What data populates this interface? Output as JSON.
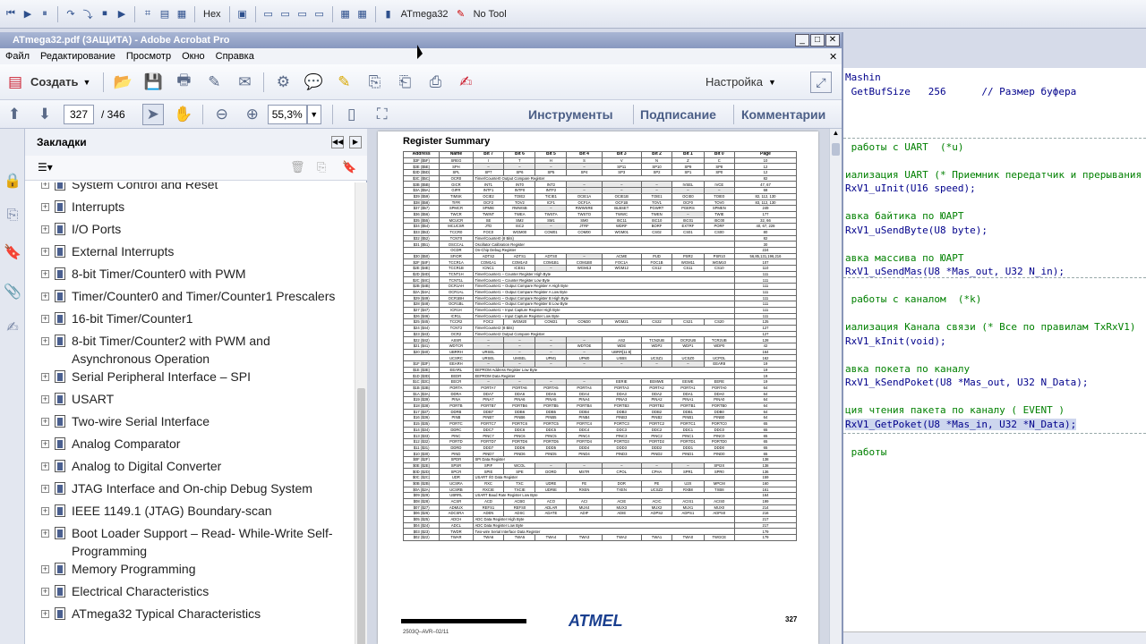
{
  "ide": {
    "toolbar_hex": "Hex",
    "device": "ATmega32",
    "tool": "No Tool"
  },
  "acrobat": {
    "title": "ATmega32.pdf (ЗАЩИТА) - Adobe Acrobat Pro",
    "menu": [
      "Файл",
      "Редактирование",
      "Просмотр",
      "Окно",
      "Справка"
    ],
    "create_label": "Создать",
    "customize_label": "Настройка",
    "page_current": "327",
    "page_total": "/ 346",
    "zoom": "55,3%",
    "nav": {
      "tools": "Инструменты",
      "sign": "Подписание",
      "comments": "Комментарии"
    },
    "bookmarks_title": "Закладки",
    "bookmarks": [
      "System Control and Reset",
      "Interrupts",
      "I/O Ports",
      "External Interrupts",
      "8-bit Timer/Counter0 with PWM",
      "Timer/Counter0 and Timer/Counter1 Prescalers",
      "16-bit Timer/Counter1",
      "8-bit Timer/Counter2 with PWM and",
      "Asynchronous Operation",
      "Serial Peripheral Interface – SPI",
      "USART",
      "Two-wire Serial Interface",
      "Analog Comparator",
      "Analog to Digital Converter",
      "JTAG Interface and On-chip Debug System",
      "IEEE 1149.1 (JTAG) Boundary-scan",
      "Boot Loader Support – Read- While-Write Self-",
      "Programming",
      "Memory Programming",
      "Electrical Characteristics",
      "ATmega32 Typical Characteristics"
    ],
    "doc": {
      "heading": "Register Summary",
      "columns": [
        "Address",
        "Name",
        "Bit 7",
        "Bit 6",
        "Bit 5",
        "Bit 4",
        "Bit 3",
        "Bit 2",
        "Bit 1",
        "Bit 0",
        "Page"
      ],
      "rows": [
        [
          "$3F ($5F)",
          "SREG",
          "I",
          "T",
          "H",
          "S",
          "V",
          "N",
          "Z",
          "C",
          "10"
        ],
        [
          "$3E ($5E)",
          "SPH",
          "–",
          "–",
          "–",
          "–",
          "SP11",
          "SP10",
          "SP9",
          "SP8",
          "12"
        ],
        [
          "$3D ($5D)",
          "SPL",
          "SP7",
          "SP6",
          "SP5",
          "SP4",
          "SP3",
          "SP2",
          "SP1",
          "SP0",
          "12"
        ],
        [
          "$3C ($5C)",
          "OCR0",
          "",
          "",
          "",
          "",
          "",
          "",
          "",
          "",
          "82"
        ],
        [
          "$3B ($5B)",
          "GICR",
          "INT1",
          "INT0",
          "INT2",
          "–",
          "–",
          "–",
          "IVSEL",
          "IVCE",
          "47, 67"
        ],
        [
          "$3A ($5A)",
          "GIFR",
          "INTF1",
          "INTF0",
          "INTF2",
          "–",
          "–",
          "–",
          "–",
          "–",
          "68"
        ],
        [
          "$39 ($59)",
          "TIMSK",
          "OCIE2",
          "TOIE2",
          "TICIE1",
          "OCIE1A",
          "OCIE1B",
          "TOIE1",
          "OCIE0",
          "TOIE0",
          "82, 112, 130"
        ],
        [
          "$38 ($58)",
          "TIFR",
          "OCF2",
          "TOV2",
          "ICF1",
          "OCF1A",
          "OCF1B",
          "TOV1",
          "OCF0",
          "TOV0",
          "83, 112, 130"
        ],
        [
          "$37 ($57)",
          "SPMCR",
          "SPMIE",
          "RWWSB",
          "–",
          "RWWSRE",
          "BLBSET",
          "PGWRT",
          "PGERS",
          "SPMEN",
          "249"
        ],
        [
          "$36 ($56)",
          "TWCR",
          "TWINT",
          "TWEA",
          "TWSTA",
          "TWSTO",
          "TWWC",
          "TWEN",
          "–",
          "TWIE",
          "177"
        ],
        [
          "$35 ($55)",
          "MCUCR",
          "SE",
          "SM2",
          "SM1",
          "SM0",
          "ISC11",
          "ISC10",
          "ISC01",
          "ISC00",
          "32, 66"
        ],
        [
          "$34 ($54)",
          "MCUCSR",
          "JTD",
          "ISC2",
          "–",
          "JTRF",
          "WDRF",
          "BORF",
          "EXTRF",
          "PORF",
          "40, 67, 228"
        ],
        [
          "$33 ($53)",
          "TCCR0",
          "FOC0",
          "WGM00",
          "COM01",
          "COM00",
          "WGM01",
          "CS02",
          "CS01",
          "CS00",
          "80"
        ],
        [
          "$32 ($52)",
          "TCNT0",
          "",
          "",
          "",
          "",
          "",
          "",
          "",
          "",
          "82"
        ],
        [
          "$31 ($51)",
          "OSCCAL",
          "",
          "",
          "",
          "",
          "",
          "",
          "",
          "",
          "30"
        ],
        [
          "",
          "OCDR",
          "",
          "",
          "",
          "",
          "",
          "",
          "",
          "",
          "224"
        ],
        [
          "$30 ($50)",
          "SFIOR",
          "ADTS2",
          "ADTS1",
          "ADTS0",
          "–",
          "ACME",
          "PUD",
          "PSR2",
          "PSR10",
          "56,85,131,196,216"
        ],
        [
          "$2F ($4F)",
          "TCCR1A",
          "COM1A1",
          "COM1A0",
          "COM1B1",
          "COM1B0",
          "FOC1A",
          "FOC1B",
          "WGM11",
          "WGM10",
          "107"
        ],
        [
          "$2E ($4E)",
          "TCCR1B",
          "ICNC1",
          "ICES1",
          "–",
          "WGM13",
          "WGM12",
          "CS12",
          "CS11",
          "CS10",
          "110"
        ],
        [
          "$2D ($4D)",
          "TCNT1H",
          "",
          "",
          "",
          "",
          "",
          "",
          "",
          "",
          "111"
        ],
        [
          "$2C ($4C)",
          "TCNT1L",
          "",
          "",
          "",
          "",
          "",
          "",
          "",
          "",
          "111"
        ],
        [
          "$2B ($4B)",
          "OCR1AH",
          "",
          "",
          "",
          "",
          "",
          "",
          "",
          "",
          "111"
        ],
        [
          "$2A ($4A)",
          "OCR1AL",
          "",
          "",
          "",
          "",
          "",
          "",
          "",
          "",
          "111"
        ],
        [
          "$29 ($49)",
          "OCR1BH",
          "",
          "",
          "",
          "",
          "",
          "",
          "",
          "",
          "111"
        ],
        [
          "$28 ($48)",
          "OCR1BL",
          "",
          "",
          "",
          "",
          "",
          "",
          "",
          "",
          "111"
        ],
        [
          "$27 ($47)",
          "ICR1H",
          "",
          "",
          "",
          "",
          "",
          "",
          "",
          "",
          "111"
        ],
        [
          "$26 ($46)",
          "ICR1L",
          "",
          "",
          "",
          "",
          "",
          "",
          "",
          "",
          "111"
        ],
        [
          "$25 ($45)",
          "TCCR2",
          "FOC2",
          "WGM20",
          "COM21",
          "COM20",
          "WGM21",
          "CS22",
          "CS21",
          "CS20",
          "125"
        ],
        [
          "$24 ($44)",
          "TCNT2",
          "",
          "",
          "",
          "",
          "",
          "",
          "",
          "",
          "127"
        ],
        [
          "$23 ($43)",
          "OCR2",
          "",
          "",
          "",
          "",
          "",
          "",
          "",
          "",
          "127"
        ],
        [
          "$22 ($42)",
          "ASSR",
          "–",
          "–",
          "–",
          "–",
          "AS2",
          "TCN2UB",
          "OCR2UB",
          "TCR2UB",
          "128"
        ],
        [
          "$21 ($41)",
          "WDTCR",
          "–",
          "–",
          "–",
          "WDTOE",
          "WDE",
          "WDP2",
          "WDP1",
          "WDP0",
          "42"
        ],
        [
          "$20 ($40)",
          "UBRRH",
          "URSEL",
          "–",
          "–",
          "–",
          "",
          "",
          "",
          "",
          "164"
        ],
        [
          "",
          "UCSRC",
          "URSEL",
          "UMSEL",
          "UPM1",
          "UPM0",
          "USBS",
          "UCSZ1",
          "UCSZ0",
          "UCPOL",
          "162"
        ],
        [
          "$1F ($3F)",
          "EEARH",
          "–",
          "–",
          "–",
          "–",
          "–",
          "–",
          "–",
          "EEAR8",
          "19"
        ],
        [
          "$1E ($3E)",
          "EEARL",
          "",
          "",
          "",
          "",
          "",
          "",
          "",
          "",
          "19"
        ],
        [
          "$1D ($3D)",
          "EEDR",
          "",
          "",
          "",
          "",
          "",
          "",
          "",
          "",
          "19"
        ],
        [
          "$1C ($3C)",
          "EECR",
          "–",
          "–",
          "–",
          "–",
          "EERIE",
          "EEMWE",
          "EEWE",
          "EERE",
          "19"
        ],
        [
          "$1B ($3B)",
          "PORTA",
          "PORTA7",
          "PORTA6",
          "PORTA5",
          "PORTA4",
          "PORTA3",
          "PORTA2",
          "PORTA1",
          "PORTA0",
          "64"
        ],
        [
          "$1A ($3A)",
          "DDRA",
          "DDA7",
          "DDA6",
          "DDA5",
          "DDA4",
          "DDA3",
          "DDA2",
          "DDA1",
          "DDA0",
          "64"
        ],
        [
          "$19 ($39)",
          "PINA",
          "PINA7",
          "PINA6",
          "PINA5",
          "PINA4",
          "PINA3",
          "PINA2",
          "PINA1",
          "PINA0",
          "64"
        ],
        [
          "$18 ($38)",
          "PORTB",
          "PORTB7",
          "PORTB6",
          "PORTB5",
          "PORTB4",
          "PORTB3",
          "PORTB2",
          "PORTB1",
          "PORTB0",
          "64"
        ],
        [
          "$17 ($37)",
          "DDRB",
          "DDB7",
          "DDB6",
          "DDB5",
          "DDB4",
          "DDB3",
          "DDB2",
          "DDB1",
          "DDB0",
          "64"
        ],
        [
          "$16 ($36)",
          "PINB",
          "PINB7",
          "PINB6",
          "PINB5",
          "PINB4",
          "PINB3",
          "PINB2",
          "PINB1",
          "PINB0",
          "64"
        ],
        [
          "$15 ($35)",
          "PORTC",
          "PORTC7",
          "PORTC6",
          "PORTC5",
          "PORTC4",
          "PORTC3",
          "PORTC2",
          "PORTC1",
          "PORTC0",
          "65"
        ],
        [
          "$14 ($34)",
          "DDRC",
          "DDC7",
          "DDC6",
          "DDC5",
          "DDC4",
          "DDC3",
          "DDC2",
          "DDC1",
          "DDC0",
          "65"
        ],
        [
          "$13 ($33)",
          "PINC",
          "PINC7",
          "PINC6",
          "PINC5",
          "PINC4",
          "PINC3",
          "PINC2",
          "PINC1",
          "PINC0",
          "65"
        ],
        [
          "$12 ($32)",
          "PORTD",
          "PORTD7",
          "PORTD6",
          "PORTD5",
          "PORTD4",
          "PORTD3",
          "PORTD2",
          "PORTD1",
          "PORTD0",
          "65"
        ],
        [
          "$11 ($31)",
          "DDRD",
          "DDD7",
          "DDD6",
          "DDD5",
          "DDD4",
          "DDD3",
          "DDD2",
          "DDD1",
          "DDD0",
          "65"
        ],
        [
          "$10 ($30)",
          "PIND",
          "PIND7",
          "PIND6",
          "PIND5",
          "PIND4",
          "PIND3",
          "PIND2",
          "PIND1",
          "PIND0",
          "65"
        ],
        [
          "$0F ($2F)",
          "SPDR",
          "",
          "",
          "",
          "",
          "",
          "",
          "",
          "",
          "138"
        ],
        [
          "$0E ($2E)",
          "SPSR",
          "SPIF",
          "WCOL",
          "–",
          "–",
          "–",
          "–",
          "–",
          "SPI2X",
          "138"
        ],
        [
          "$0D ($2D)",
          "SPCR",
          "SPIE",
          "SPE",
          "DORD",
          "MSTR",
          "CPOL",
          "CPHA",
          "SPR1",
          "SPR0",
          "136"
        ],
        [
          "$0C ($2C)",
          "UDR",
          "",
          "",
          "",
          "",
          "",
          "",
          "",
          "",
          "159"
        ],
        [
          "$0B ($2B)",
          "UCSRA",
          "RXC",
          "TXC",
          "UDRE",
          "FE",
          "DOR",
          "PE",
          "U2X",
          "MPCM",
          "160"
        ],
        [
          "$0A ($2A)",
          "UCSRB",
          "RXCIE",
          "TXCIE",
          "UDRIE",
          "RXEN",
          "TXEN",
          "UCSZ2",
          "RXB8",
          "TXB8",
          "161"
        ],
        [
          "$09 ($29)",
          "UBRRL",
          "",
          "",
          "",
          "",
          "",
          "",
          "",
          "",
          "164"
        ],
        [
          "$08 ($28)",
          "ACSR",
          "ACD",
          "ACBG",
          "ACO",
          "ACI",
          "ACIE",
          "ACIC",
          "ACIS1",
          "ACIS0",
          "199"
        ],
        [
          "$07 ($27)",
          "ADMUX",
          "REFS1",
          "REFS0",
          "ADLAR",
          "MUX4",
          "MUX3",
          "MUX2",
          "MUX1",
          "MUX0",
          "214"
        ],
        [
          "$06 ($26)",
          "ADCSRA",
          "ADEN",
          "ADSC",
          "ADATE",
          "ADIF",
          "ADIE",
          "ADPS2",
          "ADPS1",
          "ADPS0",
          "216"
        ],
        [
          "$05 ($25)",
          "ADCH",
          "",
          "",
          "",
          "",
          "",
          "",
          "",
          "",
          "217"
        ],
        [
          "$04 ($24)",
          "ADCL",
          "",
          "",
          "",
          "",
          "",
          "",
          "",
          "",
          "217"
        ],
        [
          "$03 ($23)",
          "TWDR",
          "",
          "",
          "",
          "",
          "",
          "",
          "",
          "",
          "179"
        ],
        [
          "$02 ($22)",
          "TWAR",
          "TWA6",
          "TWA5",
          "TWA4",
          "TWA3",
          "TWA2",
          "TWA1",
          "TWA0",
          "TWGCE",
          "179"
        ]
      ],
      "spans": {
        "$3C ($5C)": "Timer/Counter0 Output Compare Register",
        "$32 ($52)": "Timer/Counter0 (8 Bits)",
        "$31 ($51)": "Oscillator Calibration Register",
        "OCDR": "On-Chip Debug Register",
        "$2D ($4D)": "Timer/Counter1 – Counter Register High Byte",
        "$2C ($4C)": "Timer/Counter1 – Counter Register Low Byte",
        "$2B ($4B)": "Timer/Counter1 – Output Compare Register A High Byte",
        "$2A ($4A)": "Timer/Counter1 – Output Compare Register A Low Byte",
        "$29 ($49)": "Timer/Counter1 – Output Compare Register B High Byte",
        "$28 ($48)": "Timer/Counter1 – Output Compare Register B Low Byte",
        "$27 ($47)": "Timer/Counter1 – Input Capture Register High Byte",
        "$26 ($46)": "Timer/Counter1 – Input Capture Register Low Byte",
        "$24 ($44)": "Timer/Counter2 (8 Bits)",
        "$23 ($43)": "Timer/Counter2 Output Compare Register",
        "$1E ($3E)": "EEPROM Address Register Low Byte",
        "$1D ($3D)": "EEPROM Data Register",
        "$0F ($2F)": "SPI Data Register",
        "$0C ($2C)": "USART I/O Data Register",
        "$09 ($29)": "USART Baud Rate Register Low Byte",
        "$05 ($25)": "ADC Data Register High Byte",
        "$04 ($24)": "ADC Data Register Low Byte",
        "$03 ($23)": "Two-wire Serial Interface Data Register"
      },
      "ubrrh_note": "UBRR[11:8]",
      "page_number": "327",
      "footer_code": "2503Q–AVR–02/11",
      "logo": "ATMEL"
    }
  },
  "code": {
    "lines": [
      {
        "text": "Mashin",
        "cls": "c-blue"
      },
      {
        "text": " GetBufSize   256      // Размер буфера",
        "cls": "c-blue"
      },
      {
        "text": "",
        "cls": ""
      },
      {
        "text": "",
        "cls": ""
      },
      {
        "text": "",
        "cls": ""
      },
      {
        "text": " работы с UART  (*u)",
        "cls": "c-green"
      },
      {
        "text": "",
        "cls": ""
      },
      {
        "text": "иализация UART (* Приемник передатчик и прерывания",
        "cls": "c-green"
      },
      {
        "text": "RxV1_uInit(U16 speed);",
        "cls": "c-blue"
      },
      {
        "text": "",
        "cls": ""
      },
      {
        "text": "авка байтика по ЮАРТ",
        "cls": "c-green"
      },
      {
        "text": "RxV1_uSendByte(U8 byte);",
        "cls": "c-blue"
      },
      {
        "text": "",
        "cls": ""
      },
      {
        "text": "авка массива по ЮАРТ",
        "cls": "c-green"
      },
      {
        "text": "RxV1_uSendMas(U8 *Mas_out, U32 N_in);",
        "cls": "c-blue"
      },
      {
        "text": "",
        "cls": ""
      },
      {
        "text": " работы с каналом  (*k)",
        "cls": "c-green"
      },
      {
        "text": "",
        "cls": ""
      },
      {
        "text": "иализация Канала связи (* Все по правилам TxRxV1)",
        "cls": "c-green"
      },
      {
        "text": "RxV1_kInit(void);",
        "cls": "c-blue"
      },
      {
        "text": "",
        "cls": ""
      },
      {
        "text": "авка покета по каналу",
        "cls": "c-green"
      },
      {
        "text": "RxV1_kSendPoket(U8 *Mas_out, U32 N_Data);",
        "cls": "c-blue"
      },
      {
        "text": "",
        "cls": ""
      },
      {
        "text": "ция чтения пакета по каналу ( EVENT )",
        "cls": "c-green"
      },
      {
        "text": "RxV1_GetPoket(U8 *Mas_in, U32 *N_Data);",
        "cls": "c-blue"
      },
      {
        "text": "",
        "cls": ""
      },
      {
        "text": " работы",
        "cls": "c-green"
      }
    ]
  },
  "colors": {
    "accent": "#4b5e86",
    "title_bar": "#8898bf"
  }
}
